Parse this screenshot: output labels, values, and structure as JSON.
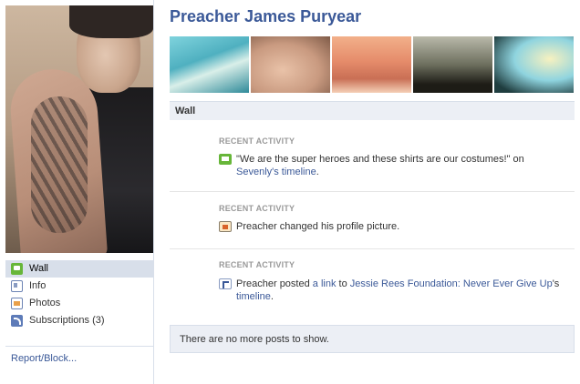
{
  "profile": {
    "name": "Preacher James Puryear"
  },
  "nav": {
    "items": [
      {
        "label": "Wall",
        "icon": "wall-icon",
        "active": true
      },
      {
        "label": "Info",
        "icon": "info-icon"
      },
      {
        "label": "Photos",
        "icon": "photos-icon"
      },
      {
        "label": "Subscriptions",
        "count": "(3)",
        "icon": "subscriptions-icon"
      }
    ],
    "report_label": "Report/Block..."
  },
  "wall": {
    "header": "Wall",
    "activities": [
      {
        "label": "RECENT ACTIVITY",
        "icon": "comment-icon",
        "text_before": "\"We are the super heroes and these shirts are our costumes!\" on ",
        "link1": "Sevenly's",
        "middle": " ",
        "link2": "timeline",
        "text_after": "."
      },
      {
        "label": "RECENT ACTIVITY",
        "icon": "profile-picture-icon",
        "text": "Preacher changed his profile picture."
      },
      {
        "label": "RECENT ACTIVITY",
        "icon": "link-icon",
        "text_before": "Preacher posted ",
        "link1": "a link",
        "middle": " to ",
        "link2": "Jessie Rees Foundation: Never Ever Give Up",
        "middle2": "'s ",
        "link3": "timeline",
        "text_after": "."
      }
    ],
    "no_more": "There are no more posts to show."
  },
  "colors": {
    "link": "#3b5998",
    "nav_active_bg": "#d8dfea",
    "bar_bg": "#eceff5",
    "label_gray": "#999999"
  }
}
